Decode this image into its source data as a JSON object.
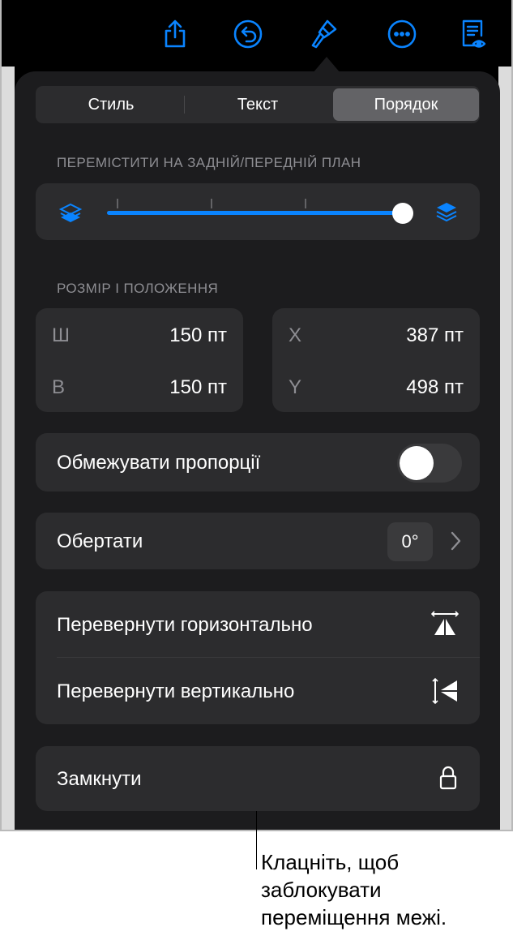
{
  "tabs": [
    {
      "label": "Стиль",
      "active": false
    },
    {
      "label": "Текст",
      "active": false
    },
    {
      "label": "Порядок",
      "active": true
    }
  ],
  "arrange": {
    "section_label": "ПЕРЕМІСТИТИ НА ЗАДНІЙ/ПЕРЕДНІЙ ПЛАН",
    "slider_value": 1.0
  },
  "size_position": {
    "section_label": "РОЗМІР І ПОЛОЖЕННЯ",
    "width_label": "Ш",
    "width_value": "150 пт",
    "height_label": "В",
    "height_value": "150 пт",
    "x_label": "X",
    "x_value": "387 пт",
    "y_label": "Y",
    "y_value": "498 пт"
  },
  "constrain": {
    "label": "Обмежувати пропорції",
    "on": false
  },
  "rotate": {
    "label": "Обертати",
    "value": "0°"
  },
  "flip": {
    "horizontal_label": "Перевернути горизонтально",
    "vertical_label": "Перевернути вертикально"
  },
  "lock": {
    "label": "Замкнути"
  },
  "callout": {
    "line1": "Клацніть, щоб",
    "line2": "заблокувати",
    "line3": "переміщення межі."
  },
  "colors": {
    "accent": "#0a84ff",
    "panel": "#1c1c1e",
    "card": "#2c2c2e"
  },
  "icons": [
    "share-icon",
    "undo-icon",
    "format-brush-icon",
    "more-icon",
    "presenter-view-icon",
    "layers-back-icon",
    "layers-front-icon",
    "chevron-right-icon",
    "flip-horizontal-icon",
    "flip-vertical-icon",
    "lock-icon"
  ]
}
